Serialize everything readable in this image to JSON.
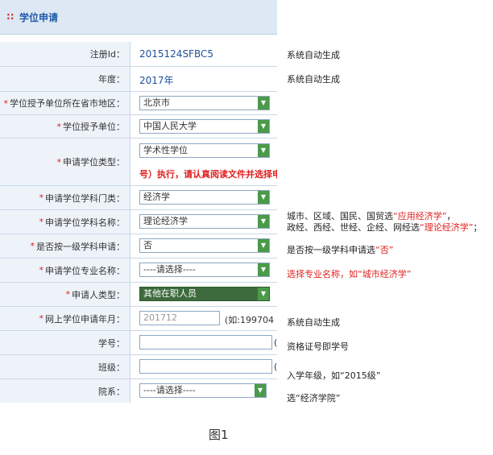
{
  "header": {
    "title": "学位申请"
  },
  "rows": {
    "reg_id": {
      "label": "注册Id：",
      "value": "2015124SFBC5"
    },
    "year": {
      "label": "年度：",
      "value": "2017年"
    },
    "region": {
      "req": "*",
      "label": "学位授予单位所在省市地区：",
      "value": "北京市"
    },
    "institution": {
      "req": "*",
      "label": "学位授予单位：",
      "value": "中国人民大学"
    },
    "degree_type": {
      "req": "*",
      "label": "申请学位类型：",
      "value": "学术性学位",
      "hint": "号）执行，请认真阅读文件并选择申请"
    },
    "discipline_class": {
      "req": "*",
      "label": "申请学位学科门类：",
      "value": "经济学"
    },
    "discipline_name": {
      "req": "*",
      "label": "申请学位学科名称：",
      "value": "理论经济学"
    },
    "first_level": {
      "req": "*",
      "label": "是否按一级学科申请：",
      "value": "否"
    },
    "major": {
      "req": "*",
      "label": "申请学位专业名称：",
      "value": "----请选择----"
    },
    "applicant_type": {
      "req": "*",
      "label": "申请人类型：",
      "value": "其他在职人员"
    },
    "apply_month": {
      "req": "*",
      "label": "网上学位申请年月：",
      "value": "201712",
      "hint": "(如:199704"
    },
    "student_no": {
      "label": "学号：",
      "hint": "("
    },
    "class": {
      "label": "班级：",
      "hint": "("
    },
    "department": {
      "label": "院系：",
      "value": "----请选择----"
    }
  },
  "notes": {
    "n1": "系统自动生成",
    "n2": "系统自动生成",
    "n3a_pre": "城市、区域、国民、国贸选",
    "n3a_red": "“应用经济学”",
    "n3a_post": "，",
    "n3b_pre": "政经、西经、世经、企经、网经选",
    "n3b_red": "“理论经济学”",
    "n3b_post": "；",
    "n4_pre": "是否按一级学科申请选",
    "n4_red": "“否”",
    "n5": "选择专业名称，如“城市经济学”",
    "n6": "系统自动生成",
    "n7": "资格证号即学号",
    "n8": "入学年级，如“2015级”",
    "n9": "选“经济学院”"
  },
  "caption": "图1"
}
